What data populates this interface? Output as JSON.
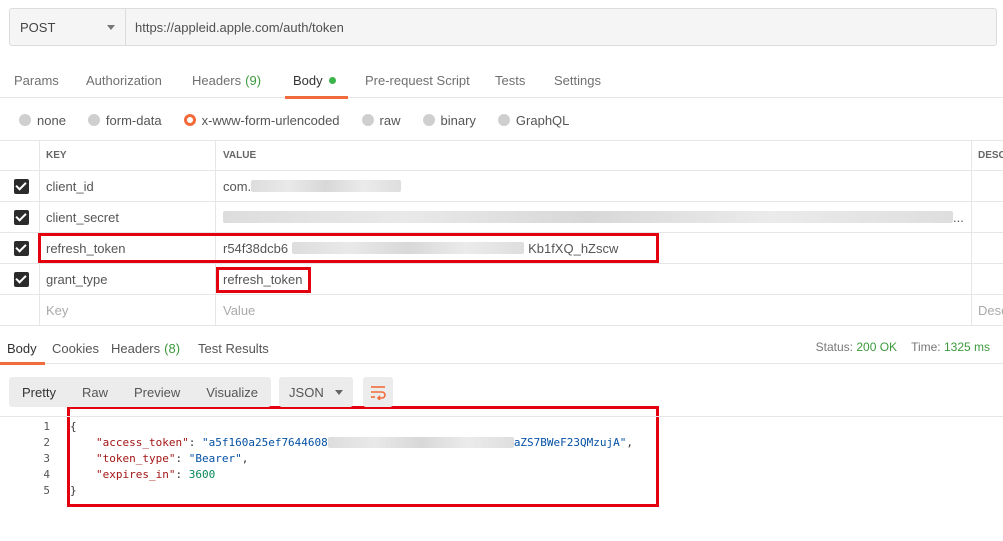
{
  "request": {
    "method": "POST",
    "url": "https://appleid.apple.com/auth/token"
  },
  "request_tabs": [
    {
      "label": "Params"
    },
    {
      "label": "Authorization"
    },
    {
      "label": "Headers",
      "count": "(9)"
    },
    {
      "label": "Body"
    },
    {
      "label": "Pre-request Script"
    },
    {
      "label": "Tests"
    },
    {
      "label": "Settings"
    }
  ],
  "body_types": [
    "none",
    "form-data",
    "x-www-form-urlencoded",
    "raw",
    "binary",
    "GraphQL"
  ],
  "body_type_selected": "x-www-form-urlencoded",
  "table": {
    "headers": {
      "key": "KEY",
      "value": "VALUE",
      "description": "DESC"
    },
    "rows": [
      {
        "key": "client_id",
        "value_start": "com.",
        "value_end": "",
        "checked": true
      },
      {
        "key": "client_secret",
        "value_start": "",
        "value_end": "...",
        "checked": true
      },
      {
        "key": "refresh_token",
        "value_start": "r54f38dcb6",
        "value_end": "Kb1fXQ_hZscw",
        "checked": true
      },
      {
        "key": "grant_type",
        "value_start": "refresh_token",
        "value_end": "",
        "checked": true
      }
    ],
    "placeholder": {
      "key": "Key",
      "value": "Value",
      "description": "Desc"
    }
  },
  "response_tabs": [
    {
      "label": "Body"
    },
    {
      "label": "Cookies"
    },
    {
      "label": "Headers",
      "count": "(8)"
    },
    {
      "label": "Test Results"
    }
  ],
  "status": {
    "status_label": "Status:",
    "status_value": "200 OK",
    "time_label": "Time:",
    "time_value": "1325 ms"
  },
  "view_modes": [
    "Pretty",
    "Raw",
    "Preview",
    "Visualize"
  ],
  "format": "JSON",
  "code_lines": {
    "line1": "{",
    "access_token_key": "\"access_token\"",
    "access_token_start": "\"a5f160a25ef7644608",
    "access_token_end": "aZS7BWeF23QMzujA\"",
    "token_type_key": "\"token_type\"",
    "token_type_value": "\"Bearer\"",
    "expires_in_key": "\"expires_in\"",
    "expires_in_value": "3600",
    "line5": "}"
  },
  "line_numbers": [
    "1",
    "2",
    "3",
    "4",
    "5"
  ],
  "colors": {
    "accent": "#f26b3a",
    "highlight": "#e3000f",
    "ok": "#3c9a3c"
  }
}
